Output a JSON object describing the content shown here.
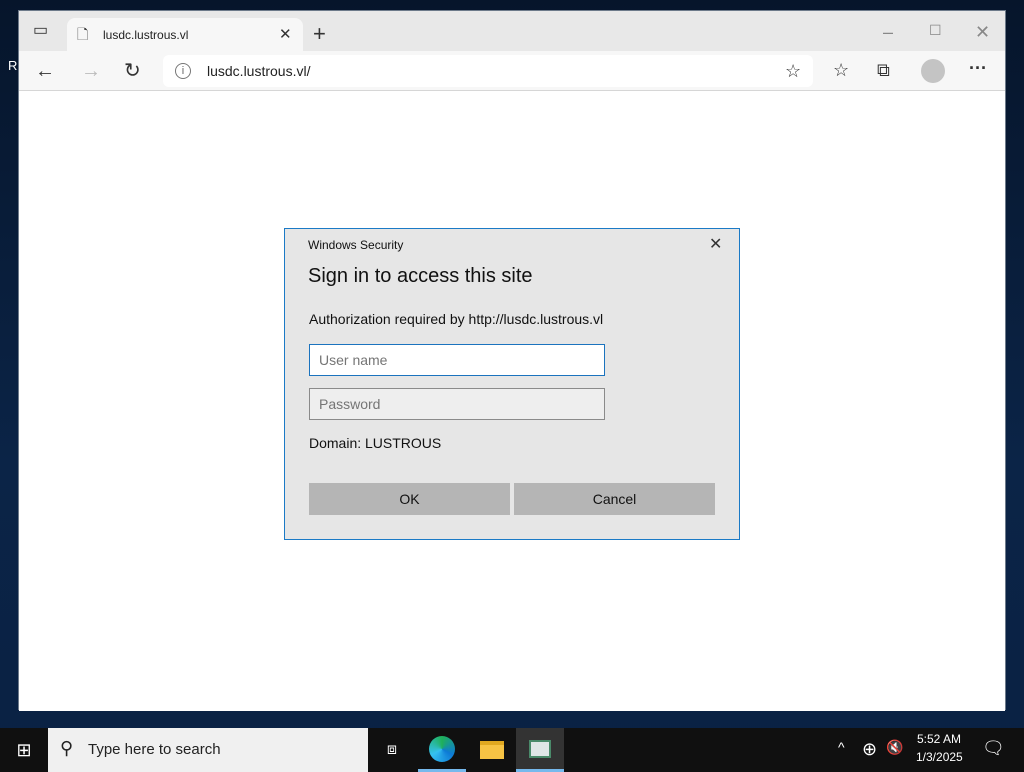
{
  "desktop": {
    "icon_label_fragment": "R"
  },
  "browser": {
    "tab": {
      "title": "lusdc.lustrous.vl"
    },
    "address": {
      "url": "lusdc.lustrous.vl/"
    }
  },
  "dialog": {
    "caption": "Windows Security",
    "title": "Sign in to access this site",
    "message": "Authorization required by http://lusdc.lustrous.vl",
    "username_placeholder": "User name",
    "password_placeholder": "Password",
    "domain": "Domain: LUSTROUS",
    "ok": "OK",
    "cancel": "Cancel"
  },
  "taskbar": {
    "search_placeholder": "Type here to search",
    "time": "5:52 AM",
    "date": "1/3/2025"
  }
}
